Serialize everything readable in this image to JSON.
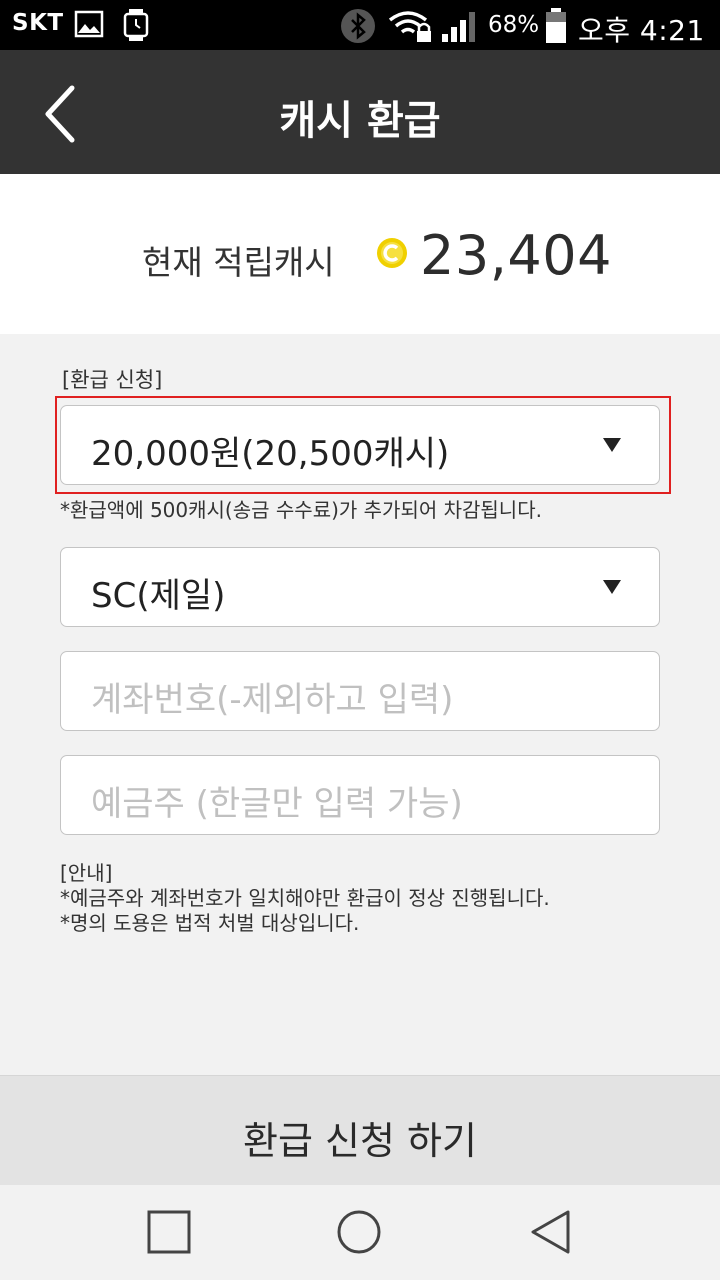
{
  "status_bar": {
    "carrier": "SKT",
    "battery": "68%",
    "time": "오후 4:21",
    "icons": [
      "gallery-icon",
      "watch-icon",
      "bluetooth-icon",
      "wifi-lock-icon",
      "signal-icon",
      "battery-icon"
    ]
  },
  "header": {
    "title": "캐시 환급",
    "back_icon": "chevron-left-icon"
  },
  "balance": {
    "label": "현재 적립캐시",
    "coin_icon": "coin-c-icon",
    "amount": "23,404",
    "coin_color": "#f0d000"
  },
  "form": {
    "section_label": "[환급 신청]",
    "amount_select": {
      "value": "20,000원(20,500캐시)"
    },
    "fee_note": "*환급액에 500캐시(송금 수수료)가 추가되어 차감됩니다.",
    "bank_select": {
      "value": "SC(제일)"
    },
    "account_input": {
      "placeholder": "계좌번호(-제외하고 입력)"
    },
    "holder_input": {
      "placeholder": "예금주 (한글만 입력 가능)"
    },
    "guide": {
      "title": "[안내]",
      "line1": "*예금주와 계좌번호가 일치해야만 환급이 정상 진행됩니다.",
      "line2": "*명의 도용은 법적 처벌 대상입니다."
    },
    "highlight_color": "#e02020"
  },
  "submit_button": {
    "label": "환급 신청 하기"
  },
  "nav_bar": {
    "items": [
      "recent-apps-icon",
      "home-icon",
      "back-icon"
    ]
  }
}
